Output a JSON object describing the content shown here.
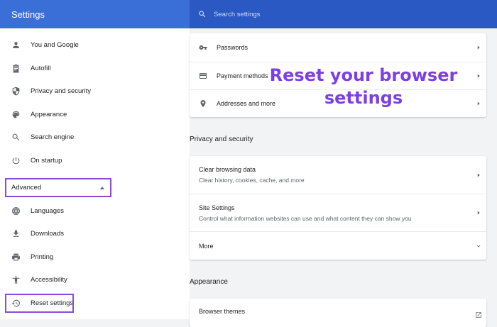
{
  "header": {
    "title": "Settings",
    "search_placeholder": "Search settings"
  },
  "sidebar": {
    "items": [
      {
        "label": "You and Google",
        "icon": "person-icon"
      },
      {
        "label": "Autofill",
        "icon": "clipboard-icon"
      },
      {
        "label": "Privacy and security",
        "icon": "shield-icon"
      },
      {
        "label": "Appearance",
        "icon": "palette-icon"
      },
      {
        "label": "Search engine",
        "icon": "search-icon"
      },
      {
        "label": "On startup",
        "icon": "power-icon"
      }
    ],
    "advanced_label": "Advanced",
    "advanced_items": [
      {
        "label": "Languages",
        "icon": "globe-icon"
      },
      {
        "label": "Downloads",
        "icon": "download-icon"
      },
      {
        "label": "Printing",
        "icon": "printer-icon"
      },
      {
        "label": "Accessibility",
        "icon": "accessibility-icon"
      },
      {
        "label": "Reset settings",
        "icon": "history-icon"
      }
    ]
  },
  "autofill_card": {
    "rows": [
      {
        "label": "Passwords",
        "icon": "key-icon"
      },
      {
        "label": "Payment methods",
        "icon": "credit-card-icon"
      },
      {
        "label": "Addresses and more",
        "icon": "location-pin-icon"
      }
    ]
  },
  "privacy": {
    "title": "Privacy and security",
    "rows": [
      {
        "label": "Clear browsing data",
        "sublabel": "Clear history, cookies, cache, and more"
      },
      {
        "label": "Site Settings",
        "sublabel": "Control what information websites can use and what content they can show you"
      }
    ],
    "more_label": "More"
  },
  "appearance": {
    "title": "Appearance",
    "rows": [
      {
        "label": "Browser themes"
      }
    ]
  },
  "overlay": {
    "line1": "Reset your browser",
    "line2": "settings",
    "color": "#7b3fe4"
  },
  "colors": {
    "header": "#3b6fd8",
    "search": "#2b59c3",
    "highlight_border": "#8a4bdc"
  }
}
